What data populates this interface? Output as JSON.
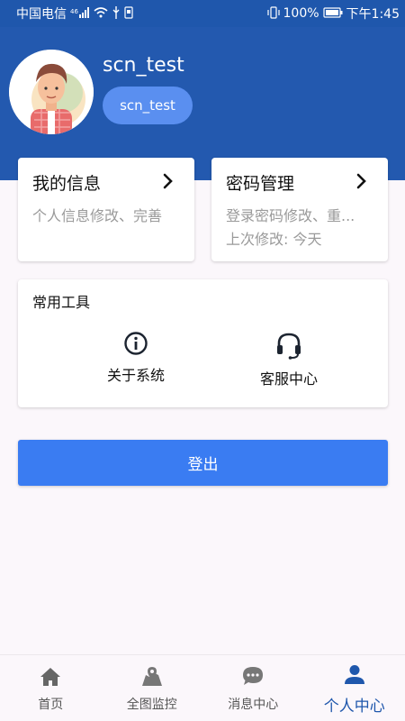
{
  "status_bar": {
    "carrier": "中国电信",
    "signal": "⁴⁶",
    "battery": "100%",
    "time": "下午1:45"
  },
  "profile": {
    "username": "scn_test",
    "chip_label": "scn_test"
  },
  "cards": {
    "info": {
      "title": "我的信息",
      "description": "个人信息修改、完善"
    },
    "password": {
      "title": "密码管理",
      "line1": "登录密码修改、重...",
      "line2": "上次修改: 今天"
    }
  },
  "tools": {
    "title": "常用工具",
    "about_label": "关于系统",
    "service_label": "客服中心"
  },
  "logout_label": "登出",
  "nav": {
    "home": "首页",
    "map": "全图监控",
    "messages": "消息中心",
    "personal": "个人中心"
  },
  "colors": {
    "header": "#2359af",
    "accent": "#3a7cf2",
    "active_nav": "#1f57ac"
  }
}
